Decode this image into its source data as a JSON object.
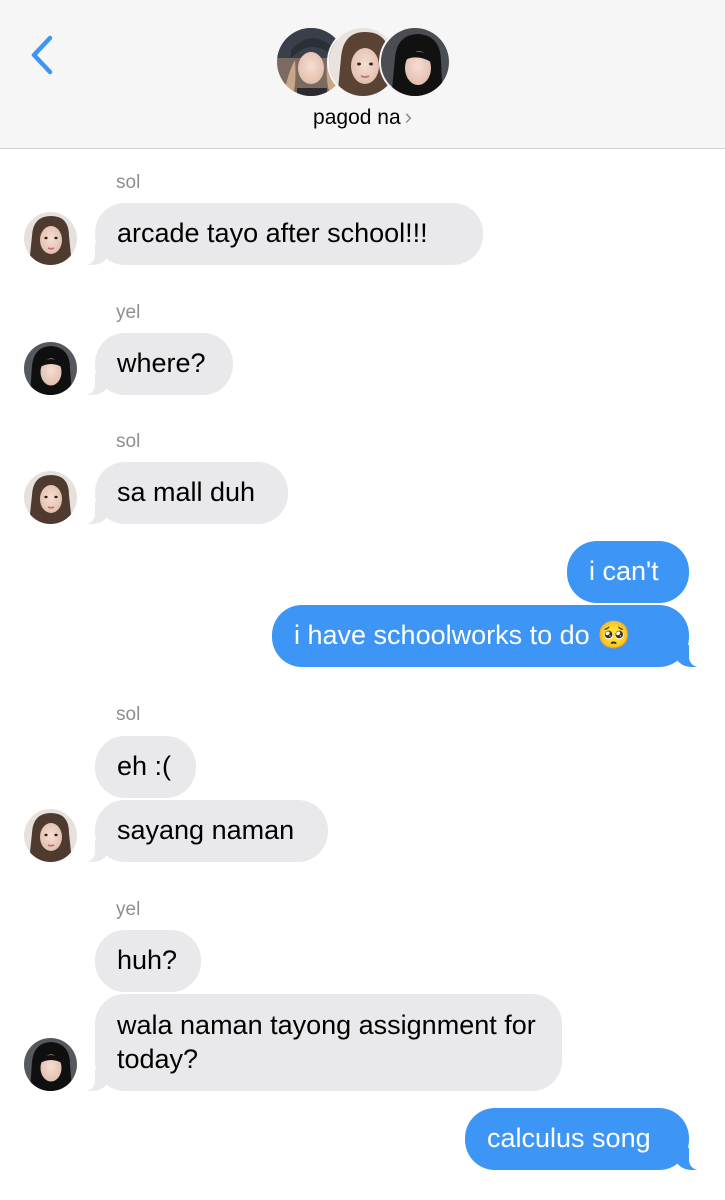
{
  "header": {
    "title": "pagod na",
    "chevron": "›",
    "back_icon": "chevron-left-icon",
    "accent_color": "#3d96f5"
  },
  "messages": [
    {
      "sender": "sol",
      "text": "arcade tayo after school!!!",
      "direction": "incoming"
    },
    {
      "sender": "yel",
      "text": "where?",
      "direction": "incoming"
    },
    {
      "sender": "sol",
      "text": "sa mall duh",
      "direction": "incoming"
    },
    {
      "text": "i can't",
      "direction": "outgoing"
    },
    {
      "text": "i have schoolworks to do 🥺",
      "direction": "outgoing"
    },
    {
      "sender": "sol",
      "text": "eh :(",
      "direction": "incoming"
    },
    {
      "text": "sayang naman",
      "direction": "incoming"
    },
    {
      "sender": "yel",
      "text": "huh?",
      "direction": "incoming"
    },
    {
      "text": "wala naman tayong assignment for today?",
      "direction": "incoming"
    },
    {
      "text": "calculus song",
      "direction": "outgoing"
    }
  ],
  "colors": {
    "incoming_bubble": "#e9e9eb",
    "outgoing_bubble": "#3d96f5",
    "sender_label": "#8e8e93"
  }
}
